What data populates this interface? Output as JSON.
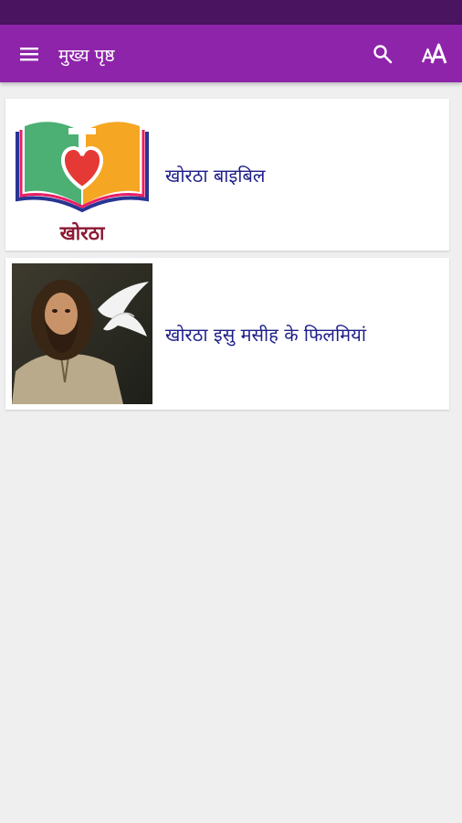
{
  "app_bar": {
    "title": "मुख्य पृष्ठ",
    "icons": [
      "menu-icon",
      "search-icon",
      "font-size-icon"
    ]
  },
  "items": [
    {
      "title": "खोरठा बाइबिल",
      "logo_text": "खोरठा",
      "icon": "bible-heart-logo"
    },
    {
      "title": "खोरठा इसु मसीह के फिलमियां",
      "icon": "jesus-film-thumbnail"
    }
  ],
  "colors": {
    "status_bar": "#4a1460",
    "app_bar": "#8e24aa",
    "background": "#efefef",
    "item_title": "#1f1f8a",
    "logo_text": "#8b1a33"
  }
}
